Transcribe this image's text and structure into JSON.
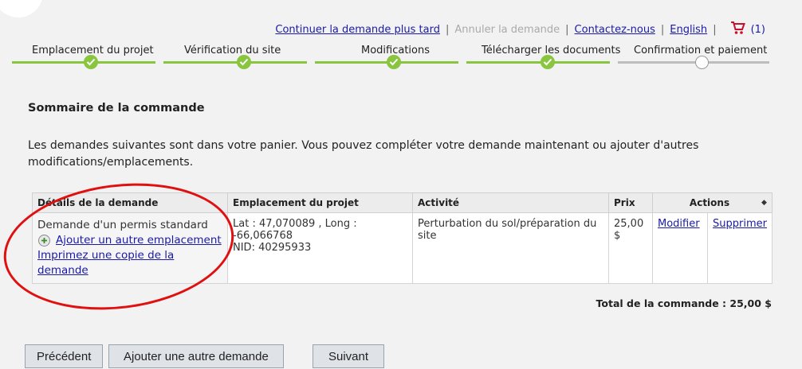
{
  "header": {
    "links": {
      "continue_later": "Continuer la demande plus tard",
      "cancel": "Annuler la demande",
      "contact": "Contactez-nous",
      "english": "English"
    },
    "separator": "|",
    "cart_count": "(1)"
  },
  "steps": [
    {
      "label": "Emplacement du projet",
      "status": "done"
    },
    {
      "label": "Vérification du site",
      "status": "done"
    },
    {
      "label": "Modifications",
      "status": "done"
    },
    {
      "label": "Télécharger les documents",
      "status": "done"
    },
    {
      "label": "Confirmation et paiement",
      "status": "current"
    }
  ],
  "colors": {
    "done": "#8ac53f",
    "pending": "#bdbdbd",
    "link": "#1a1aa8",
    "highlight": "#e01010"
  },
  "summary": {
    "title": "Sommaire de la commande",
    "intro": "Les demandes suivantes sont dans votre panier. Vous pouvez compléter votre demande maintenant ou ajouter d'autres modifications/emplacements."
  },
  "table": {
    "headers": {
      "details": "Détails de la demande",
      "location": "Emplacement du projet",
      "activity": "Activité",
      "price": "Prix",
      "actions": "Actions"
    },
    "row": {
      "request_type": "Demande d'un permis standard",
      "add_location": "Ajouter un autre emplacement",
      "print_copy": "Imprimez une copie de la demande",
      "location_line1": "Lat : 47,070089 ,   Long : -66,066768",
      "location_line2": "NID: 40295933",
      "activity": "Perturbation du sol/préparation du site",
      "price": "25,00 $",
      "modify": "Modifier",
      "delete": "Supprimer"
    }
  },
  "total": "Total de la commande : 25,00 $",
  "buttons": {
    "previous": "Précédent",
    "add_request": "Ajouter une autre demande",
    "next": "Suivant"
  }
}
